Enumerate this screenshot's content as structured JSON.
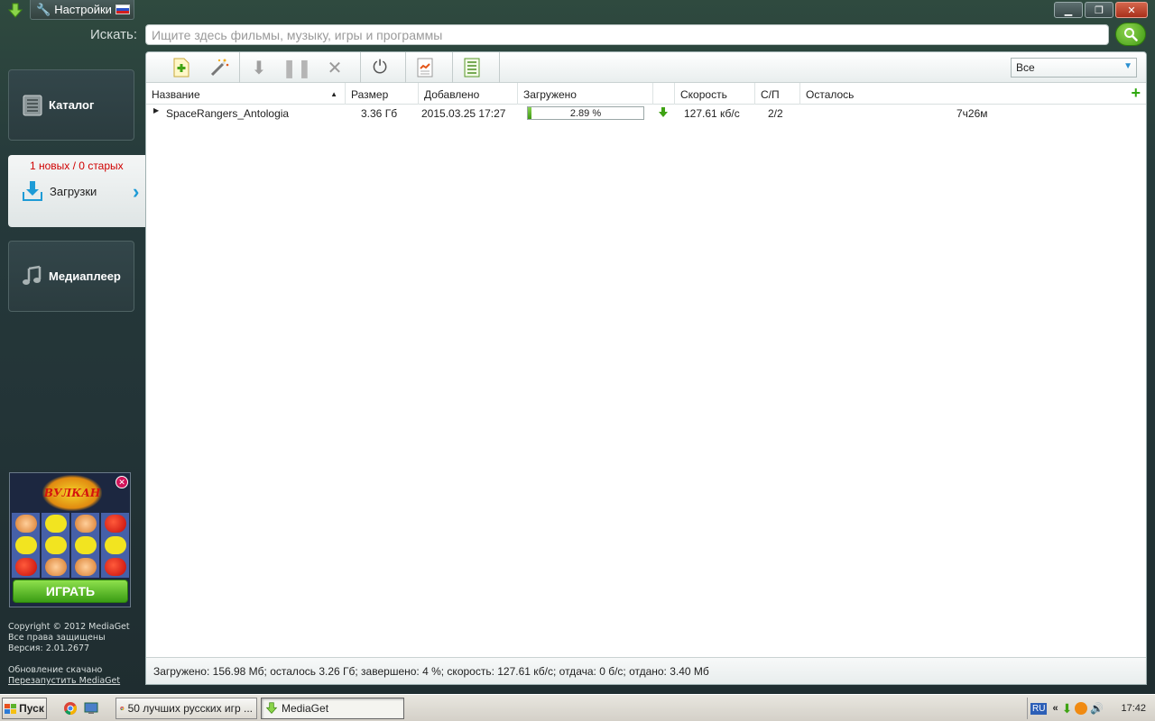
{
  "titlebar": {
    "settings_label": "Настройки",
    "minimize": "▁",
    "maximize": "❐",
    "close": "✕"
  },
  "search": {
    "label": "Искать:",
    "placeholder": "Ищите здесь фильмы, музыку, игры и программы"
  },
  "sidebar": {
    "catalog_label": "Каталог",
    "downloads_counter": "1 новых / 0 старых",
    "downloads_label": "Загрузки",
    "player_label": "Медиаплеер"
  },
  "ad": {
    "logo_text": "ВУЛКАН",
    "play_label": "ИГРАТЬ"
  },
  "footer": {
    "copyright": "Copyright © 2012 MediaGet",
    "rights": "Все права защищены",
    "version": "Версия: 2.01.2677",
    "update": "Обновление скачано",
    "restart": "Перезапустить MediaGet"
  },
  "filter": {
    "selected": "Все"
  },
  "table": {
    "columns": [
      "Название",
      "Размер",
      "Добавлено",
      "Загружено",
      "",
      "Скорость",
      "С/П",
      "Осталось"
    ],
    "rows": [
      {
        "name": "SpaceRangers_Antologia",
        "size": "3.36 Гб",
        "added": "2015.03.25 17:27",
        "progress_text": "2.89 %",
        "progress": 0.0289,
        "speed": "127.61 кб/с",
        "seeds_peers": "2/2",
        "remaining": "7ч26м"
      }
    ]
  },
  "status": "Загружено: 156.98 Мб; осталось 3.26 Гб; завершено: 4 %; скорость: 127.61 кб/с; отдача: 0 б/с; отдано: 3.40 Мб",
  "taskbar": {
    "start_label": "Пуск",
    "tasks": [
      "50 лучших русских игр ...",
      "MediaGet"
    ],
    "lang": "RU",
    "clock": "17:42"
  },
  "colors": {
    "accent_green": "#3f9a13",
    "counter_red": "#d00000",
    "link_blue": "#1e9bd6"
  }
}
